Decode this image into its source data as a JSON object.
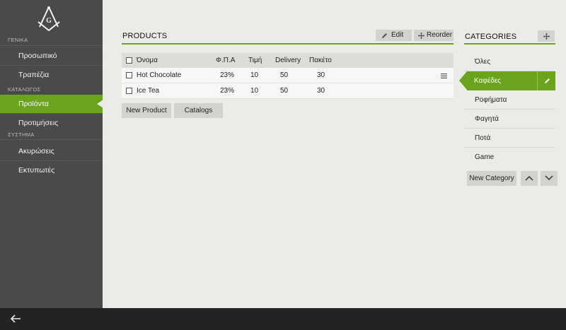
{
  "sidebar": {
    "sections": [
      {
        "label": "ΓΕΝΙΚΑ",
        "items": [
          {
            "label": "Προσωπικό"
          },
          {
            "label": "Τραπέζια"
          }
        ]
      },
      {
        "label": "ΚΑΤΑΛΟΓΟΣ",
        "items": [
          {
            "label": "Προϊόντα",
            "active": true
          },
          {
            "label": "Προτιμήσεις"
          }
        ]
      },
      {
        "label": "ΣΥΣΤΗΜΑ",
        "items": [
          {
            "label": "Ακυρώσεις"
          },
          {
            "label": "Εκτυπωτές"
          }
        ]
      }
    ],
    "logo_icon": "masonic-compass-g-logo"
  },
  "products": {
    "title": "PRODUCTS",
    "edit_label": "Edit",
    "reorder_label": "Reorder",
    "columns": [
      "Όνομα",
      "Φ.Π.Α",
      "Τιμή",
      "Delivery",
      "Πακέτο"
    ],
    "rows": [
      {
        "name": "Hot Chocolate",
        "vat": "23%",
        "price": "10",
        "delivery": "50",
        "package": "30"
      },
      {
        "name": "Ice Tea",
        "vat": "23%",
        "price": "10",
        "delivery": "50",
        "package": "30"
      }
    ],
    "new_product_label": "New Product",
    "catalogs_label": "Catalogs"
  },
  "categories": {
    "title": "CATEGORIES",
    "items": [
      {
        "label": "Όλες"
      },
      {
        "label": "Καφέδες",
        "active": true
      },
      {
        "label": "Ροφήματα"
      },
      {
        "label": "Φαγητά"
      },
      {
        "label": "Ποτά"
      },
      {
        "label": "Game"
      }
    ],
    "new_category_label": "New Category"
  },
  "colors": {
    "accent": "#6aa31c",
    "sidebar": "#4a4a4a",
    "bottombar": "#232323",
    "background": "#ebebe7"
  }
}
